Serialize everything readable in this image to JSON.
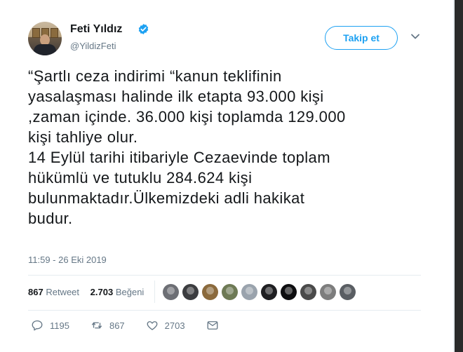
{
  "user": {
    "name": "Feti Yıldız",
    "handle": "@YildizFeti"
  },
  "follow_label": "Takip et",
  "tweet_text": "“Şartlı ceza indirimi “kanun teklifinin\nyasalaşması halinde ilk etapta 93.000 kişi\n,zaman içinde. 36.000  kişi toplamda 129.000\nkişi tahliye olur.\n14 Eylül tarihi itibariyle Cezaevinde toplam\nhükümlü ve tutuklu 284.624 kişi\nbulunmaktadır.Ülkemizdeki adli hakikat\nbudur.",
  "timestamp": "11:59 - 26 Eki 2019",
  "stats": {
    "retweets_count": "867",
    "retweets_label": "Retweet",
    "likes_count": "2.703",
    "likes_label": "Beğeni"
  },
  "likers": [
    {
      "color": "#6d6f75"
    },
    {
      "color": "#3c3d40"
    },
    {
      "color": "#8b6a3d"
    },
    {
      "color": "#6e7a55"
    },
    {
      "color": "#9aa3ad"
    },
    {
      "color": "#1f1f22"
    },
    {
      "color": "#0e0e10"
    },
    {
      "color": "#4a4a4a"
    },
    {
      "color": "#7d7d7d"
    },
    {
      "color": "#5a5e63"
    }
  ],
  "actions": {
    "reply_count": "1195",
    "retweet_count": "867",
    "like_count": "2703"
  },
  "icons": {
    "verified": "verified-badge-icon",
    "dropdown": "chevron-down-icon",
    "reply": "reply-icon",
    "retweet": "retweet-icon",
    "like": "heart-icon",
    "message": "direct-message-icon"
  },
  "colors": {
    "accent": "#1da1f2",
    "secondary_text": "#657786",
    "border": "#e6ecf0"
  }
}
